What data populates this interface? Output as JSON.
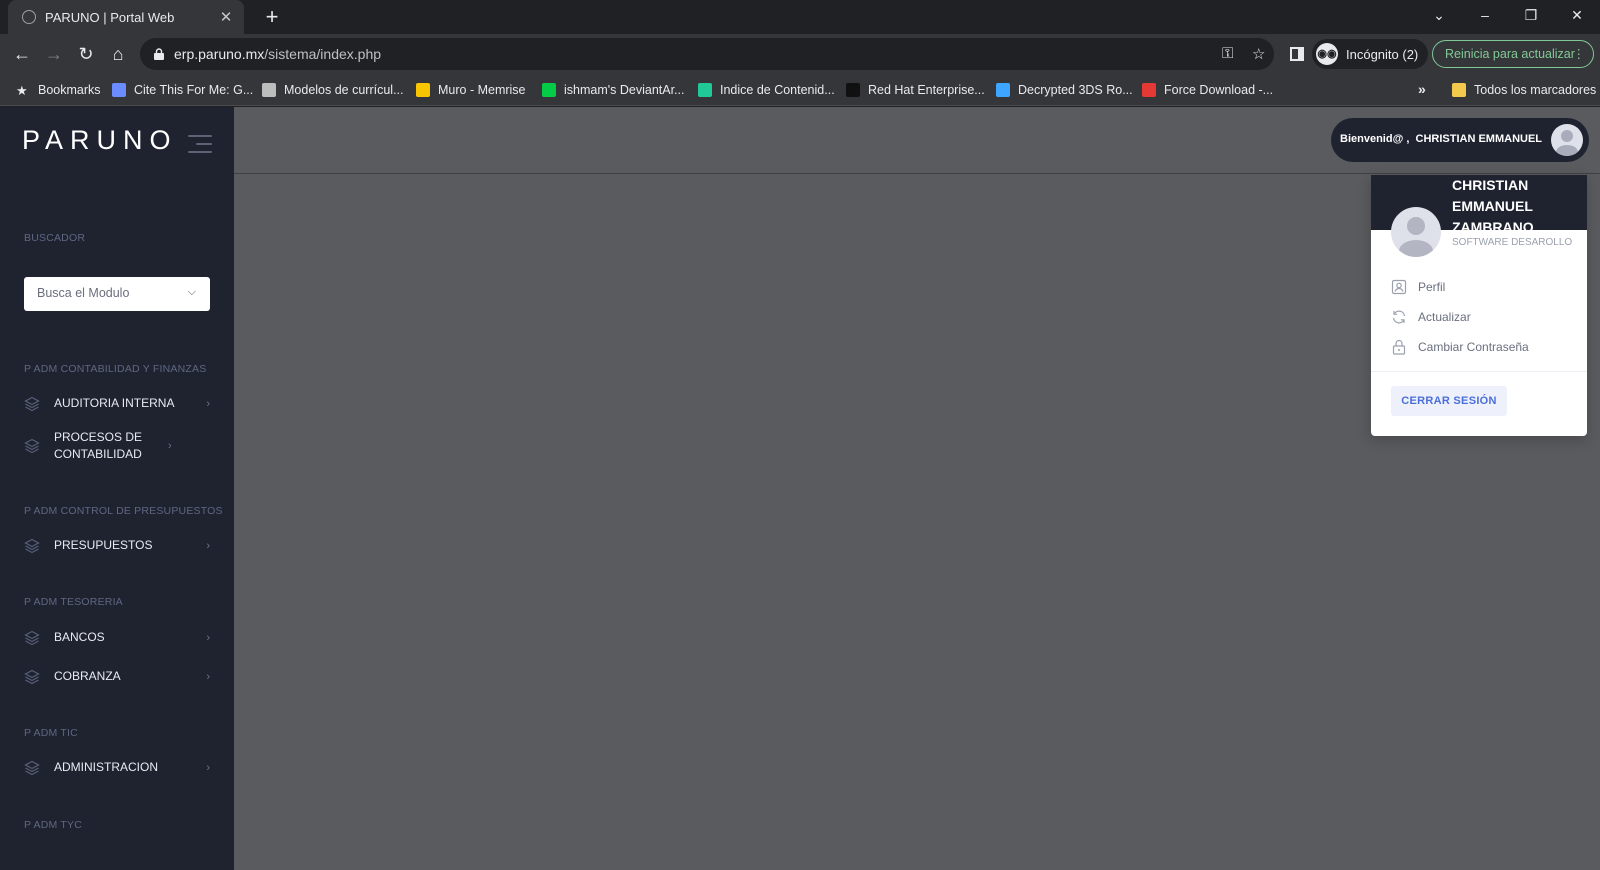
{
  "browser": {
    "tab_title": "PARUNO | Portal Web",
    "url_domain": "erp.paruno.mx",
    "url_path": "/sistema/index.php",
    "incognito_label": "Incógnito (2)",
    "update_label": "Reinicia para actualizar",
    "bookmarks": [
      {
        "label": "Bookmarks",
        "icon": "star-icon",
        "color": "#e8eaed"
      },
      {
        "label": "Cite This For Me: G...",
        "icon": "book-icon",
        "color": "#6b8cff"
      },
      {
        "label": "Modelos de currícul...",
        "icon": "globe-icon",
        "color": "#bdbdbd"
      },
      {
        "label": "Muro - Memrise",
        "icon": "memrise-icon",
        "color": "#f7c600"
      },
      {
        "label": "ishmam's DeviantAr...",
        "icon": "deviantart-icon",
        "color": "#05cc47"
      },
      {
        "label": "Indice de Contenid...",
        "icon": "diamond-icon",
        "color": "#20c997"
      },
      {
        "label": "Red Hat Enterprise...",
        "icon": "redhat-icon",
        "color": "#111111"
      },
      {
        "label": "Decrypted 3DS Ro...",
        "icon": "hexagon-icon",
        "color": "#3ea6ff"
      },
      {
        "label": "Force Download -...",
        "icon": "fd-icon",
        "color": "#e53935"
      }
    ],
    "all_bookmarks_label": "Todos los marcadores"
  },
  "app": {
    "logo": "PARUNO",
    "search_section_label": "BUSCADOR",
    "search_placeholder": "Busca el Modulo",
    "sections": [
      {
        "label": "P ADM CONTABILIDAD Y FINANZAS",
        "items": [
          "AUDITORIA INTERNA",
          "PROCESOS DE CONTABILIDAD"
        ]
      },
      {
        "label": "P ADM CONTROL DE PRESUPUESTOS",
        "items": [
          "PRESUPUESTOS"
        ]
      },
      {
        "label": "P ADM TESORERIA",
        "items": [
          "BANCOS",
          "COBRANZA"
        ]
      },
      {
        "label": "P ADM TIC",
        "items": [
          "ADMINISTRACION"
        ]
      },
      {
        "label": "P ADM TYC",
        "items": []
      }
    ],
    "welcome_prefix": "Bienvenid@ ,",
    "welcome_name": "CHRISTIAN EMMANUEL",
    "user_menu": {
      "full_name": "CHRISTIAN EMMANUEL ZAMBRANO",
      "role": "SOFTWARE DESAROLLO",
      "items": [
        "Perfil",
        "Actualizar",
        "Cambiar Contraseña"
      ],
      "logout_label": "CERRAR SESIÓN"
    },
    "colors": {
      "sidebar": "#1f2330",
      "accent": "#4b6fd8",
      "overlay": "#5a5b5e"
    }
  }
}
